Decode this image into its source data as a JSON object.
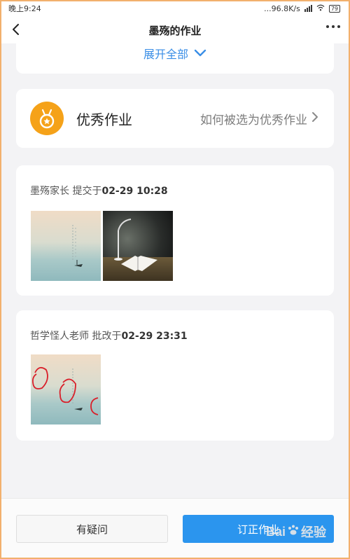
{
  "status_bar": {
    "time": "晚上9:24",
    "network_speed": "...96.8K/s",
    "battery": "79"
  },
  "nav": {
    "title": "墨殇的作业"
  },
  "expand": {
    "label": "展开全部"
  },
  "excellent": {
    "title": "优秀作业",
    "link_label": "如何被选为优秀作业"
  },
  "submission": {
    "author": "墨殇家长",
    "action": "提交于",
    "datetime": "02-29 10:28"
  },
  "review": {
    "author": "哲学怪人老师",
    "action": "批改于",
    "datetime": "02-29 23:31"
  },
  "bottom": {
    "question_label": "有疑问",
    "correct_label": "订正作业"
  },
  "watermark": {
    "brand_left": "Bai",
    "brand_right": "经验"
  }
}
